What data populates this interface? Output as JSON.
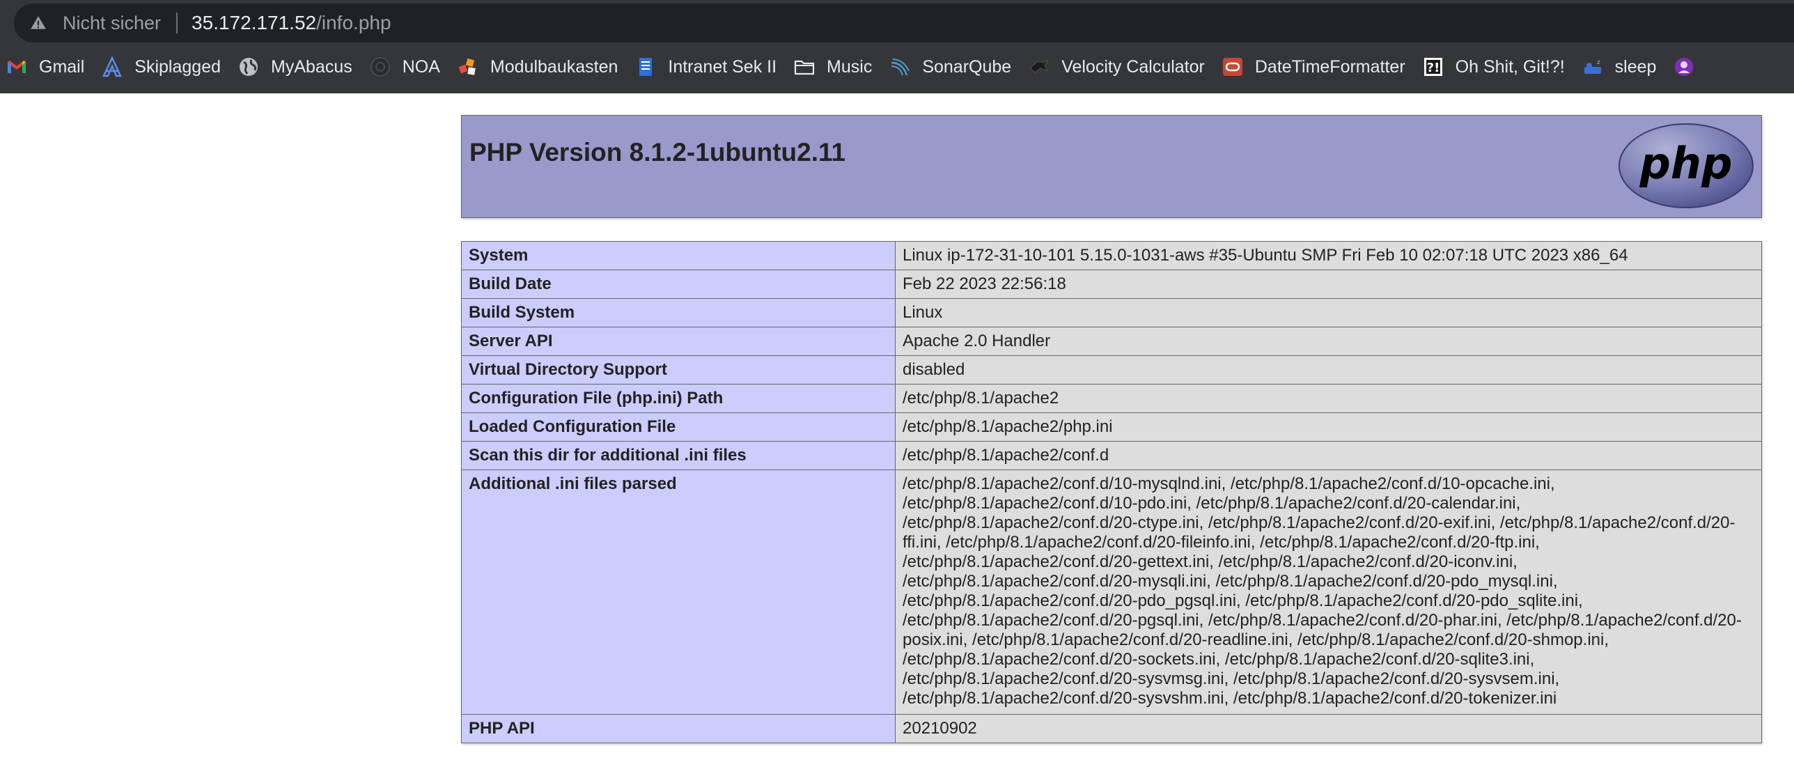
{
  "browser": {
    "security_label": "Nicht sicher",
    "url_host": "35.172.171.52",
    "url_path": "/info.php",
    "bookmarks": [
      {
        "label": "Gmail",
        "icon": "gmail-icon"
      },
      {
        "label": "Skiplagged",
        "icon": "skiplagged-icon"
      },
      {
        "label": "MyAbacus",
        "icon": "globe-icon"
      },
      {
        "label": "NOA",
        "icon": "noa-icon"
      },
      {
        "label": "Modulbaukasten",
        "icon": "modulbaukasten-icon"
      },
      {
        "label": "Intranet Sek II",
        "icon": "intranet-icon"
      },
      {
        "label": "Music",
        "icon": "folder-icon"
      },
      {
        "label": "SonarQube",
        "icon": "sonarqube-icon"
      },
      {
        "label": "Velocity Calculator",
        "icon": "velocity-icon"
      },
      {
        "label": "DateTimeFormatter",
        "icon": "oracle-icon"
      },
      {
        "label": "Oh Shit, Git!?!",
        "icon": "ohshitgit-icon"
      },
      {
        "label": "sleep",
        "icon": "sleep-icon"
      }
    ]
  },
  "page": {
    "title": "PHP Version 8.1.2-1ubuntu2.11",
    "logo_text": "php",
    "rows": [
      {
        "key": "System",
        "value": "Linux ip-172-31-10-101 5.15.0-1031-aws #35-Ubuntu SMP Fri Feb 10 02:07:18 UTC 2023 x86_64"
      },
      {
        "key": "Build Date",
        "value": "Feb 22 2023 22:56:18"
      },
      {
        "key": "Build System",
        "value": "Linux"
      },
      {
        "key": "Server API",
        "value": "Apache 2.0 Handler"
      },
      {
        "key": "Virtual Directory Support",
        "value": "disabled"
      },
      {
        "key": "Configuration File (php.ini) Path",
        "value": "/etc/php/8.1/apache2"
      },
      {
        "key": "Loaded Configuration File",
        "value": "/etc/php/8.1/apache2/php.ini"
      },
      {
        "key": "Scan this dir for additional .ini files",
        "value": "/etc/php/8.1/apache2/conf.d"
      },
      {
        "key": "Additional .ini files parsed",
        "value": "/etc/php/8.1/apache2/conf.d/10-mysqlnd.ini, /etc/php/8.1/apache2/conf.d/10-opcache.ini, /etc/php/8.1/apache2/conf.d/10-pdo.ini, /etc/php/8.1/apache2/conf.d/20-calendar.ini, /etc/php/8.1/apache2/conf.d/20-ctype.ini, /etc/php/8.1/apache2/conf.d/20-exif.ini, /etc/php/8.1/apache2/conf.d/20-ffi.ini, /etc/php/8.1/apache2/conf.d/20-fileinfo.ini, /etc/php/8.1/apache2/conf.d/20-ftp.ini, /etc/php/8.1/apache2/conf.d/20-gettext.ini, /etc/php/8.1/apache2/conf.d/20-iconv.ini, /etc/php/8.1/apache2/conf.d/20-mysqli.ini, /etc/php/8.1/apache2/conf.d/20-pdo_mysql.ini, /etc/php/8.1/apache2/conf.d/20-pdo_pgsql.ini, /etc/php/8.1/apache2/conf.d/20-pdo_sqlite.ini, /etc/php/8.1/apache2/conf.d/20-pgsql.ini, /etc/php/8.1/apache2/conf.d/20-phar.ini, /etc/php/8.1/apache2/conf.d/20-posix.ini, /etc/php/8.1/apache2/conf.d/20-readline.ini, /etc/php/8.1/apache2/conf.d/20-shmop.ini, /etc/php/8.1/apache2/conf.d/20-sockets.ini, /etc/php/8.1/apache2/conf.d/20-sqlite3.ini, /etc/php/8.1/apache2/conf.d/20-sysvmsg.ini, /etc/php/8.1/apache2/conf.d/20-sysvsem.ini, /etc/php/8.1/apache2/conf.d/20-sysvshm.ini, /etc/php/8.1/apache2/conf.d/20-tokenizer.ini"
      },
      {
        "key": "PHP API",
        "value": "20210902"
      }
    ]
  },
  "colors": {
    "header_bg": "#9999cc",
    "key_cell_bg": "#ccccff",
    "value_cell_bg": "#dddddd",
    "chrome_bg": "#35363a"
  }
}
